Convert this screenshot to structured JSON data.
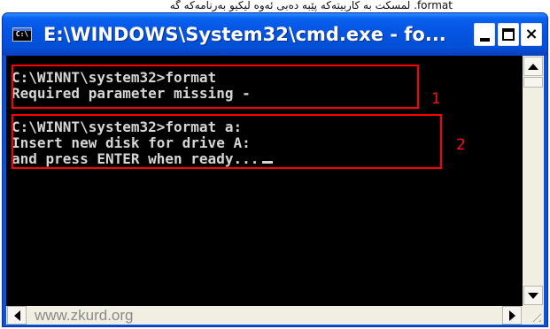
{
  "caption": {
    "text": "format. لمسکت به کاربیتەکە پێبە دەبی ئەوە لیکیو بەرنامەکە گە"
  },
  "window": {
    "title": "E:\\WINDOWS\\System32\\cmd.exe - fo...",
    "icon_label": "C:\\",
    "controls": {
      "minimize": "minimize",
      "maximize": "maximize",
      "close": "×"
    }
  },
  "console": {
    "lines": [
      "C:\\WINNT\\system32>format",
      "Required parameter missing -",
      "",
      "C:\\WINNT\\system32>format a:",
      "Insert new disk for drive A:",
      "and press ENTER when ready..."
    ]
  },
  "annotations": {
    "box1_label": "1",
    "box2_label": "2",
    "color": "#ff0000"
  },
  "scrollbar": {
    "watermark": "www.zkurd.org"
  },
  "colors": {
    "titlebar": "#0555e4",
    "console_bg": "#000000",
    "console_text": "#d6d6d6",
    "scrollbar_bg": "#f1efe2"
  }
}
